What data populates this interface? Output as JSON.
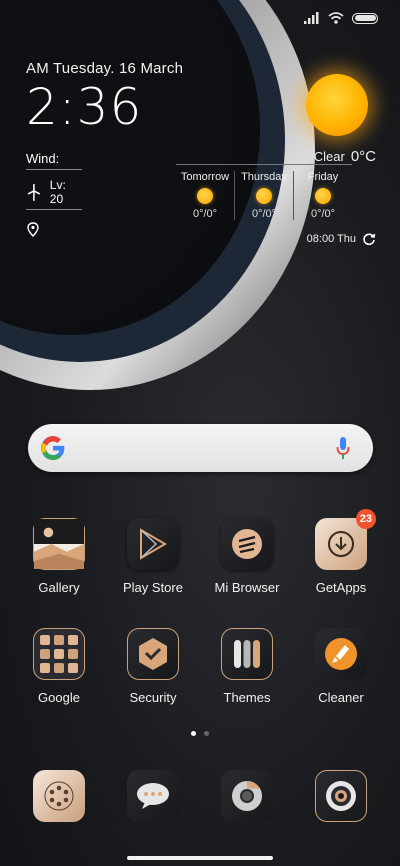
{
  "clock": {
    "date": "AM Tuesday. 16 March",
    "time": "2:36",
    "wind_label": "Wind:",
    "level": "Lv: 20"
  },
  "weather": {
    "condition": "Clear",
    "temperature": "0°C",
    "forecast": [
      {
        "day": "Tomorrow",
        "range": "0°/0°"
      },
      {
        "day": "Thursday",
        "range": "0°/0°"
      },
      {
        "day": "Friday",
        "range": "0°/0°"
      }
    ],
    "updated": "08:00 Thu"
  },
  "search": {
    "logo": "google-g-icon",
    "voice_icon": "microphone-icon"
  },
  "apps_row1": [
    {
      "label": "Gallery",
      "icon": "gallery-icon"
    },
    {
      "label": "Play Store",
      "icon": "play-store-icon"
    },
    {
      "label": "Mi Browser",
      "icon": "mi-browser-icon"
    },
    {
      "label": "GetApps",
      "icon": "getapps-icon",
      "badge": "23"
    }
  ],
  "apps_row2": [
    {
      "label": "Google",
      "icon": "google-folder-icon"
    },
    {
      "label": "Security",
      "icon": "security-icon"
    },
    {
      "label": "Themes",
      "icon": "themes-icon"
    },
    {
      "label": "Cleaner",
      "icon": "cleaner-icon"
    }
  ],
  "dock": [
    {
      "icon": "phone-dialer-icon"
    },
    {
      "icon": "messages-icon"
    },
    {
      "icon": "chrome-icon"
    },
    {
      "icon": "camera-icon"
    }
  ],
  "pages": {
    "count": 2,
    "active": 0
  },
  "colors": {
    "badge": "#f2522e",
    "sun": "#ffb300",
    "accent_orange": "#f0932b"
  }
}
